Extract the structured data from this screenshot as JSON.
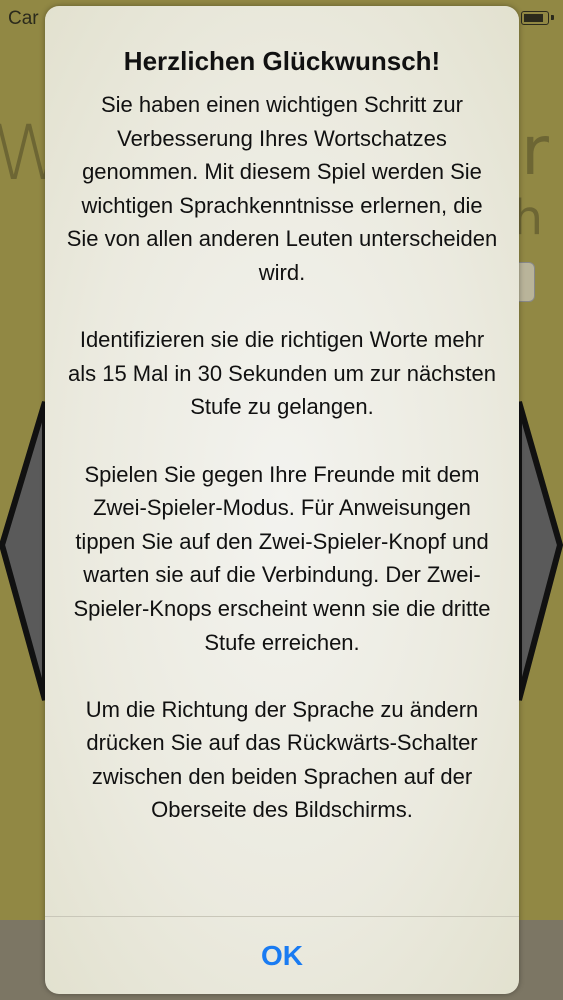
{
  "status_bar": {
    "carrier": "Car"
  },
  "background": {
    "word_left": "W",
    "word_right": "r",
    "word_right2": "h"
  },
  "alert": {
    "title": "Herzlichen Glückwunsch!",
    "paragraphs": [
      "Sie haben einen wichtigen Schritt zur Verbesserung Ihres Wortschatzes genommen. Mit diesem Spiel werden Sie wichtigen Sprachkenntnisse erlernen, die Sie von allen anderen Leuten unterscheiden wird.",
      "Identifizieren sie die richtigen Worte mehr als 15 Mal in 30 Sekunden um zur nächsten Stufe zu gelangen.",
      "Spielen Sie gegen Ihre Freunde mit dem Zwei-Spieler-Modus. Für Anweisungen tippen Sie auf den Zwei-Spieler-Knopf und warten sie auf die Verbindung. Der Zwei-Spieler-Knops erscheint wenn sie die dritte Stufe erreichen.",
      "Um die Richtung der Sprache zu ändern drücken Sie auf das Rückwärts-Schalter zwischen den beiden Sprachen auf der Oberseite des Bildschirms."
    ],
    "ok_label": "OK",
    "accent_color": "#1a7bf2"
  }
}
